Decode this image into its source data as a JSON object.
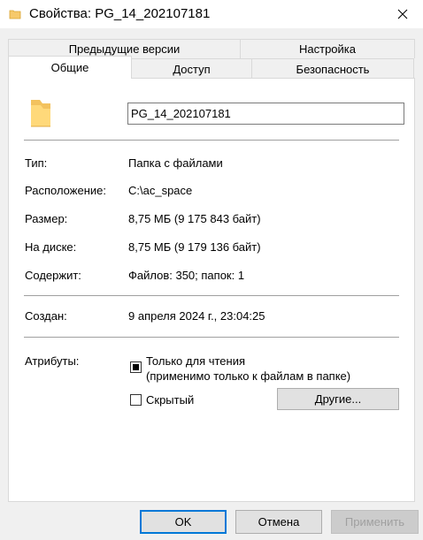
{
  "window": {
    "title": "Свойства: PG_14_202107181"
  },
  "tabs": {
    "back_row": [
      "Предыдущие версии",
      "Настройка"
    ],
    "front_row": [
      "Общие",
      "Доступ",
      "Безопасность"
    ],
    "active": "Общие"
  },
  "general": {
    "name_value": "PG_14_202107181",
    "rows": [
      {
        "label": "Тип:",
        "value": "Папка с файлами"
      },
      {
        "label": "Расположение:",
        "value": "C:\\ac_space"
      },
      {
        "label": "Размер:",
        "value": "8,75 МБ (9 175 843 байт)"
      },
      {
        "label": "На диске:",
        "value": "8,75 МБ (9 179 136 байт)"
      },
      {
        "label": "Содержит:",
        "value": "Файлов: 350; папок: 1"
      }
    ],
    "created": {
      "label": "Создан:",
      "value": "9 апреля 2024 г., 23:04:25"
    },
    "attributes": {
      "label": "Атрибуты:",
      "readonly_line1": "Только для чтения",
      "readonly_line2": "(применимо только к файлам в папке)",
      "readonly_checked": true,
      "hidden_label": "Скрытый",
      "hidden_checked": false,
      "other_button": "Другие..."
    }
  },
  "buttons": {
    "ok": "OK",
    "cancel": "Отмена",
    "apply": "Применить"
  },
  "icons": {
    "folder": "folder-icon",
    "close": "close-icon"
  },
  "colors": {
    "folder": "#f6c96b",
    "focus_border": "#0078d7"
  }
}
